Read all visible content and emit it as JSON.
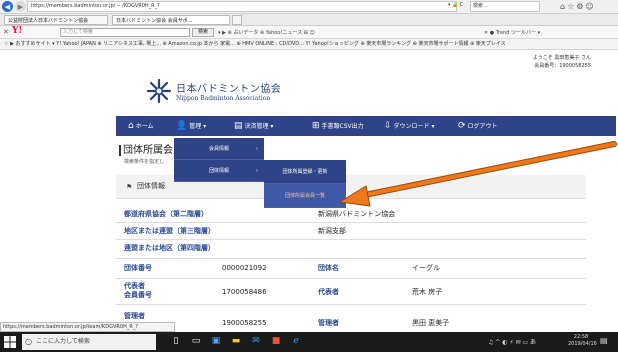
{
  "browser": {
    "url": "https://members.badminton.or.jp/ -- /KDGVR0H_R_?",
    "url_controls": "▾ 🔒 C",
    "search_text": "検索...",
    "tabs": [
      "公益財団法人日本バドミントン協会",
      "日本バドミントン協会 会員サポ...",
      ""
    ],
    "yahoo": {
      "close": "✕",
      "logo": "Y!",
      "search_placeholder": "入力して検索",
      "search_button": "検索",
      "links": "▾  ▶  ⊕ 占いデータ  ⊕ Yahoo!ニュース  ⊞  ☺",
      "right": "✕  ● Trend ツールバー ▾"
    },
    "favorites": "☆ ▶ おすすめサイト ▾   Y! Yahoo! JAPAN   ⊕ リニアシネス工事, 場上...   ⊕ Amazon.co.jp 本から 家電...   ⊕ HMV ONLINE : CD/DVD...   Y! Yahoo!ショッピング   ⊕ 楽天市場ランキング   ⊕ 楽天市場サポート情報   ⊕ 楽天プレイス"
  },
  "header": {
    "welcome_line1": "ようこそ",
    "welcome_name": "黒田恵美子",
    "welcome_suffix": "さん",
    "member_no": "会員番号：1900058255",
    "org_name_jp": "日本バドミントン協会",
    "org_name_en": "Nippon Badminton Association"
  },
  "nav": {
    "items": [
      {
        "icon": "⌂",
        "label": "ホーム"
      },
      {
        "icon": "👤",
        "label": "管理 ▾"
      },
      {
        "icon": "▤",
        "label": "決済管理 ▾"
      },
      {
        "icon": "⊞",
        "label": "手書類CSV出力"
      },
      {
        "icon": "⇩",
        "label": "ダウンロード ▾"
      },
      {
        "icon": "⟳",
        "label": "ログアウト"
      }
    ],
    "dropdown1": [
      {
        "label": "会員情報",
        "arrow": "›"
      },
      {
        "label": "団体情報",
        "arrow": "›"
      }
    ],
    "dropdown2": [
      {
        "label": "団体所属登録・更新"
      },
      {
        "label": "団体所属会員一覧"
      }
    ]
  },
  "page": {
    "section_title": "団体所属会員",
    "section_desc": "検索条件を指定し",
    "group_title": "団体情報",
    "rows": [
      {
        "label": "都道府県協会（第二階層）",
        "value": "新潟県バドミントン協会"
      },
      {
        "label": "地区または連盟（第三階層）",
        "value": "新潟支部"
      },
      {
        "label": "連盟または地区（第四階層）",
        "value": ""
      }
    ],
    "grid": [
      {
        "l1": "団体番号",
        "v1": "0000021092",
        "l2": "団体名",
        "v2": "イーグル"
      },
      {
        "l1": "代表者\n会員番号",
        "v1": "1700058486",
        "l2": "代表者",
        "v2": "荒木 房子"
      },
      {
        "l1": "管理者",
        "v1": "1900058255",
        "l2": "管理者",
        "v2": "黒田 恵美子"
      }
    ]
  },
  "status_url": "https://members.badminton.or.jp/team/KDGVR0H_R_?",
  "taskbar": {
    "search_placeholder": "ここに入力して検索",
    "tray": "♫  ^  ◐  ⚡  ✉  ▭  あ",
    "clock_time": "22:58",
    "clock_date": "2019/04/16"
  },
  "colors": {
    "nav_bg": "#2f4488",
    "label_blue": "#2b4a92",
    "arrow_orange": "#f07818"
  }
}
